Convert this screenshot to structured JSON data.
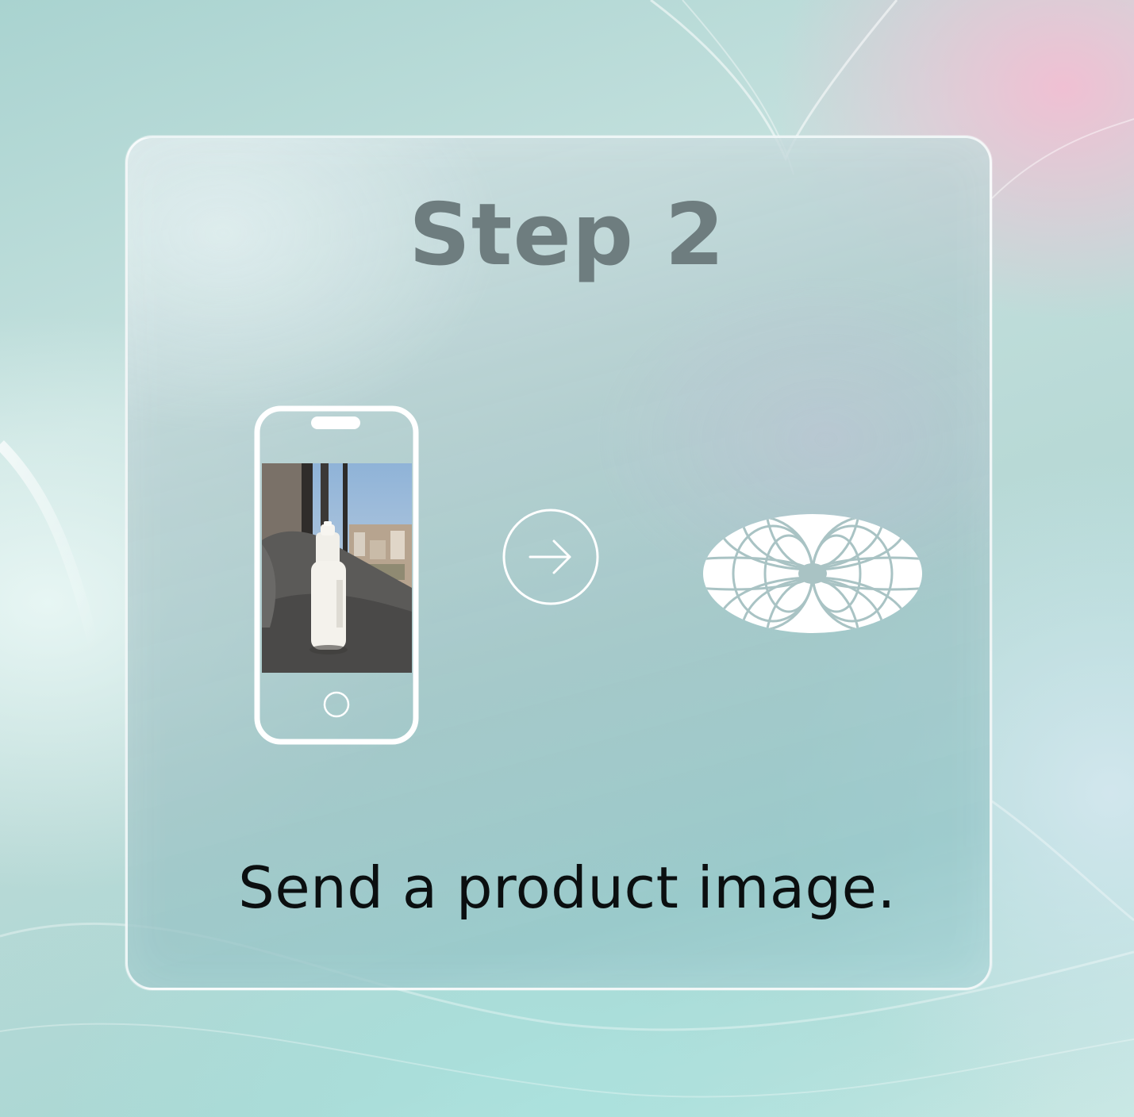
{
  "title": "Step 2",
  "caption": "Send a product image.",
  "icons": {
    "phone": "smartphone-with-product-photo-icon",
    "arrow": "arrow-right-circle-icon",
    "logo": "ai-brand-logo-icon"
  },
  "colors": {
    "title": "#6e7d7f",
    "caption": "#0b0f10",
    "icon_stroke": "#ffffff",
    "logo_lines": "#a9c3c4",
    "accent_pink": "#f2bed2",
    "background_teal": "#a9d3d0"
  }
}
